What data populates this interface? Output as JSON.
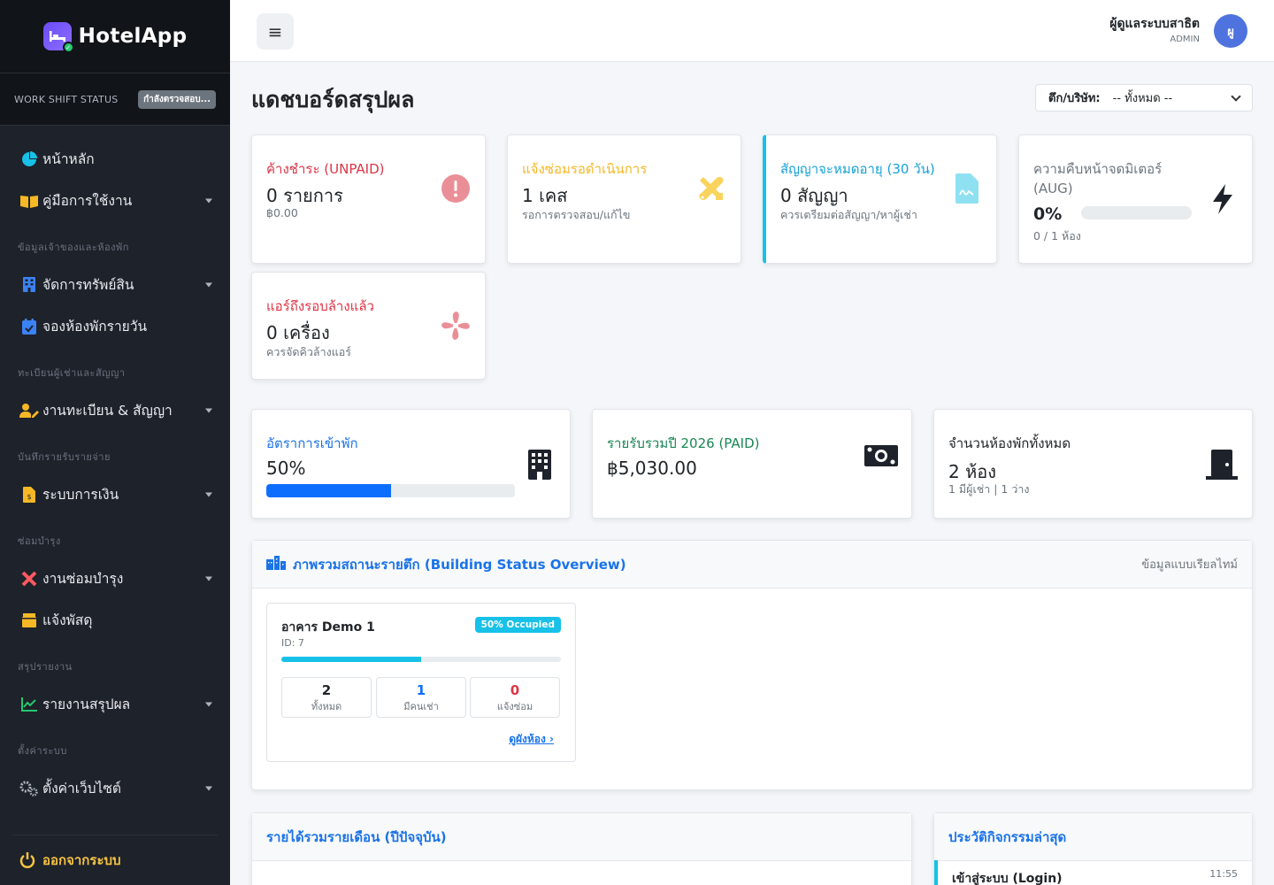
{
  "brand": {
    "name": "HotelApp"
  },
  "shift": {
    "label": "WORK SHIFT STATUS",
    "badge": "กำลังตรวจสอบ..."
  },
  "menu": {
    "home": "หน้าหลัก",
    "manual": "คู่มือการใช้งาน",
    "section_owner": "ข้อมูลเจ้าของและห้องพัก",
    "assets": "จัดการทรัพย์สิน",
    "daily_booking": "จองห้องพักรายวัน",
    "section_tenant": "ทะเบียนผู้เช่าและสัญญา",
    "registration": "งานทะเบียน & สัญญา",
    "section_finance": "บันทึกรายรับรายจ่าย",
    "finance": "ระบบการเงิน",
    "section_maintenance": "ซ่อมบำรุง",
    "maintenance": "งานซ่อมบำรุง",
    "parcel": "แจ้งพัสดุ",
    "section_report": "สรุปรายงาน",
    "report": "รายงานสรุปผล",
    "section_settings": "ตั้งค่าระบบ",
    "website_settings": "ตั้งค่าเว็บไซต์",
    "logout": "ออกจากระบบ"
  },
  "topbar": {
    "menu_icon": "≡",
    "user_name": "ผู้ดูแลระบบสาธิต",
    "user_role": "ADMIN",
    "avatar": "ผู"
  },
  "page": {
    "title": "แดชบอร์ดสรุปผล"
  },
  "filter": {
    "label": "ตึก/บริษัท:",
    "value": "-- ทั้งหมด --"
  },
  "stats": {
    "unpaid": {
      "title": "ค้างชำระ (UNPAID)",
      "value": "0 รายการ",
      "sub": "฿0.00"
    },
    "repair": {
      "title": "แจ้งซ่อมรอดำเนินการ",
      "value": "1 เคส",
      "sub": "รอการตรวจสอบ/แก้ไข"
    },
    "contract": {
      "title": "สัญญาจะหมดอายุ (30 วัน)",
      "value": "0 สัญญา",
      "sub": "ควรเตรียมต่อสัญญา/หาผู้เช่า"
    },
    "meter": {
      "title": "ความคืบหน้าจดมิเตอร์",
      "title2": "(AUG)",
      "value": "0%",
      "progress": 0,
      "sub": "0 / 1 ห้อง"
    },
    "aircon": {
      "title": "แอร์ถึงรอบล้างแล้ว",
      "value": "0 เครื่อง",
      "sub": "ควรจัดคิวล้างแอร์"
    }
  },
  "metrics": {
    "occupancy": {
      "title": "อัตราการเข้าพัก",
      "value": "50%",
      "progress": 50
    },
    "revenue": {
      "title": "รายรับรวมปี 2026 (PAID)",
      "value": "฿5,030.00"
    },
    "rooms": {
      "title": "จำนวนห้องพักทั้งหมด",
      "value": "2 ห้อง",
      "sub": "1 มีผู้เช่า | 1 ว่าง"
    }
  },
  "overview": {
    "title": "ภาพรวมสถานะรายตึก (Building Status Overview)",
    "realtime": "ข้อมูลแบบเรียลไทม์",
    "building": {
      "name": "อาคาร Demo 1",
      "id": "ID: 7",
      "badge": "50% Occupied",
      "occupancy": 50,
      "total": "2",
      "total_label": "ทั้งหมด",
      "rented": "1",
      "rented_label": "มีคนเช่า",
      "repair": "0",
      "repair_label": "แจ้งซ่อม",
      "link": "ดูผังห้อง"
    }
  },
  "monthly": {
    "title": "รายได้รวมรายเดือน (ปีปัจจุบัน)"
  },
  "activity": {
    "title": "ประวัติกิจกรรมล่าสุด",
    "item": "เข้าสู่ระบบ (Login)",
    "time": "11:55"
  },
  "colors": {
    "danger": "#dc3545",
    "warning": "#f6b824",
    "info": "#17a2b8",
    "success": "#198754",
    "primary": "#0d6efd",
    "accent": "#1a73e8"
  }
}
